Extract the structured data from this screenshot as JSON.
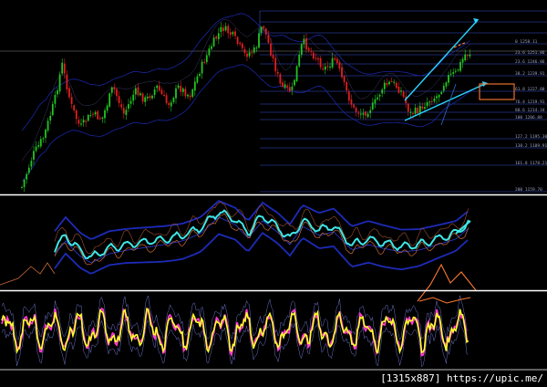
{
  "watermark": "[1315x887] https://upic.me/",
  "colors": {
    "background": "#000000",
    "bull_candle": "#22c522",
    "bear_candle": "#e02020",
    "fib_lines": "#3a4fd0",
    "trendline": "#2ad6ff",
    "indicator_main": "#3fe6e6",
    "band_outer": "#1d2bb8",
    "band_inner": "#c86a3a",
    "oscillator_main": "#ffff2a",
    "oscillator_signal": "#ff3ad0",
    "forecast_orange": "#ff7a33",
    "separator": "#ffffff"
  },
  "chart_data": [
    {
      "type": "candlestick",
      "panel": "price",
      "title": "",
      "fib_levels": [
        {
          "label": "0 1258.11"
        },
        {
          "label": "23.6 1251.86"
        },
        {
          "label": "23.6 1246.86"
        },
        {
          "label": "38.2 1239.91"
        },
        {
          "label": "61.8 1227.00"
        },
        {
          "label": "76.4 1219.91"
        },
        {
          "label": "88.6 1214.34"
        },
        {
          "label": "100 1206.88"
        },
        {
          "label": "127.2 1195.30"
        },
        {
          "label": "138.2 1189.91"
        },
        {
          "label": "161.8 1178.21"
        },
        {
          "label": "200 1159.70"
        }
      ],
      "trend_channel": "rising",
      "highlight_box": "around 61.8 level"
    },
    {
      "type": "line",
      "panel": "indicator",
      "title": "",
      "series_count": 5
    },
    {
      "type": "line",
      "panel": "oscillator",
      "title": "",
      "series_count": 4
    }
  ]
}
